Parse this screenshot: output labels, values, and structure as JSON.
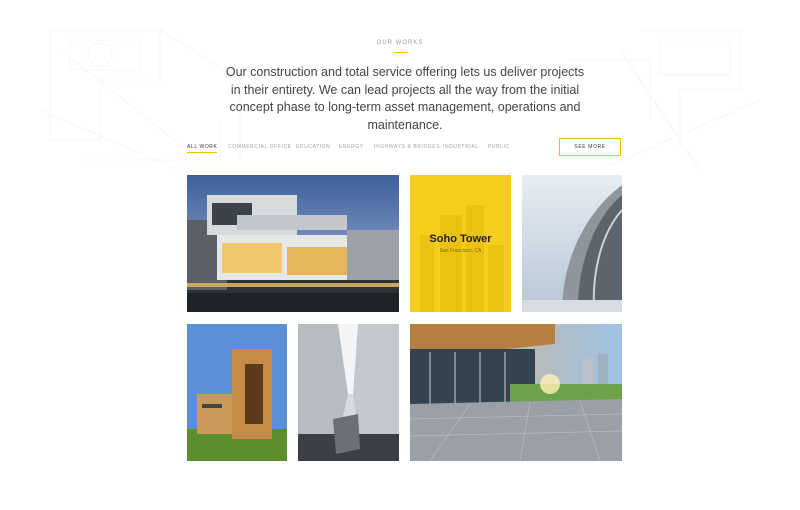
{
  "section": {
    "label": "OUR WORKS",
    "intro": "Our construction and total service offering lets us deliver projects in their entirety. We can lead projects all the way from the initial concept phase to long-term asset management, operations and maintenance."
  },
  "filters": [
    {
      "label": "ALL WORK",
      "active": true
    },
    {
      "label": "COMMERCIAL OFFICE",
      "active": false
    },
    {
      "label": "EDUCATION",
      "active": false
    },
    {
      "label": "ENERGY",
      "active": false
    },
    {
      "label": "HIGHWAYS & BRIDGES",
      "active": false
    },
    {
      "label": "INDUSTRIAL",
      "active": false
    },
    {
      "label": "PUBLIC",
      "active": false
    }
  ],
  "see_more_label": "SEE MORE",
  "featured": {
    "title": "Soho Tower",
    "subtitle": "San Francisco, CA"
  },
  "colors": {
    "accent": "#f2c200",
    "text": "#444444",
    "muted": "#a3a3a3"
  }
}
